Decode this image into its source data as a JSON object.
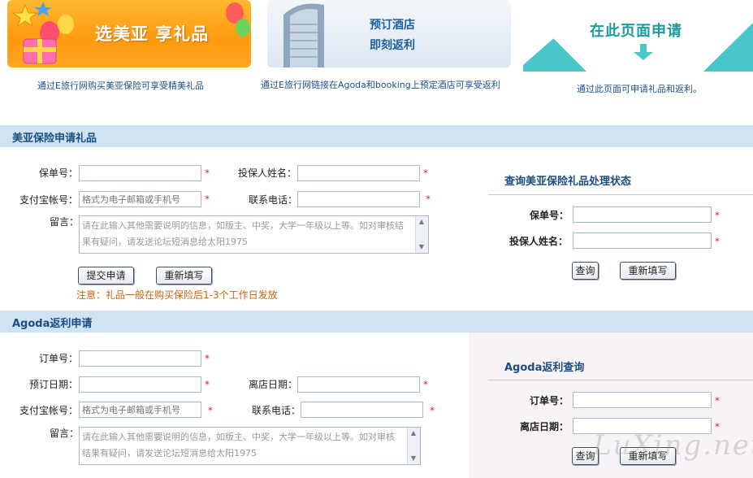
{
  "banners": [
    {
      "title": "选美亚 享礼品",
      "caption": "通过E旅行网购买美亚保险可享受精美礼品"
    },
    {
      "line1": "预订酒店",
      "line2": "即刻返利",
      "caption": "通过E旅行网链接在Agoda和booking上预定酒店可享受返利"
    },
    {
      "title": "在此页面申请",
      "caption": "通过此页面可申请礼品和返利。"
    }
  ],
  "insurance": {
    "section_title": "美亚保险申请礼品",
    "policy_label": "保单号：",
    "holder_label": "投保人姓名：",
    "alipay_label": "支付宝帐号：",
    "alipay_placeholder": "格式为电子邮箱或手机号",
    "phone_label": "联系电话：",
    "message_label": "留言：",
    "message_placeholder": "请在此输入其他需要说明的信息，如版主、中奖，大学一年级以上等。如对审核结果有疑问，请发送论坛短消息给太阳1975",
    "submit_label": "提交申请",
    "reset_label": "重新填写",
    "notice": "注意：礼品一般在购买保险后1-3个工作日发放",
    "query": {
      "title": "查询美亚保险礼品处理状态",
      "policy_label": "保单号：",
      "holder_label": "投保人姓名：",
      "query_label": "查询",
      "reset_label": "重新填写"
    }
  },
  "agoda": {
    "section_title": "Agoda返利申请",
    "order_label": "订单号：",
    "booking_date_label": "预订日期：",
    "checkout_label": "离店日期：",
    "alipay_label": "支付宝帐号：",
    "alipay_placeholder": "格式为电子邮箱或手机号",
    "phone_label": "联系电话：",
    "message_label": "留言：",
    "message_placeholder": "请在此输入其他需要说明的信息，如版主、中奖，大学一年级以上等。如对审核结果有疑问，请发送论坛短消息给太阳1975",
    "query": {
      "title": "Agoda返利查询",
      "order_label": "订单号：",
      "checkout_label": "离店日期：",
      "query_label": "查询",
      "reset_label": "重新填写"
    }
  },
  "required_mark": "*",
  "watermark": "LuXing.net",
  "colors": {
    "accent": "#1c4d80",
    "section_bg": "#cfe3f3",
    "notice": "#c8640c",
    "required": "#e0231c"
  }
}
